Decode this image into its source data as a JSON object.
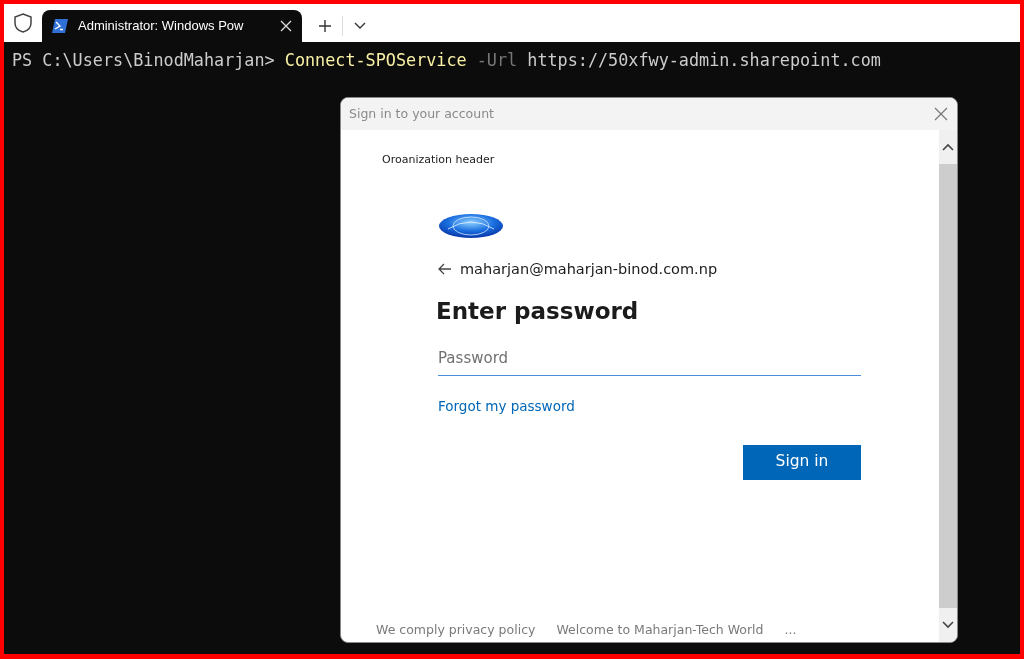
{
  "tab_bar": {
    "tabs": [
      {
        "title": "Administrator: Windows Pow",
        "selected": true
      }
    ]
  },
  "terminal": {
    "lines": [
      {
        "prompt": "PS C:\\Users\\BinodMaharjan>",
        "command": "Connect-SPOService",
        "parameter": "-Url",
        "argument": "https://50xfwy-admin.sharepoint.com"
      }
    ]
  },
  "dialog": {
    "title": "Sign in to your account",
    "organization_header": "Oroanization header",
    "account": "maharjan@maharjan-binod.com.np",
    "heading": "Enter password",
    "password_field": {
      "placeholder": "Password"
    },
    "forgot_link": "Forgot my password",
    "sign_in_button": "Sign in",
    "footer": [
      "We comply privacy policy",
      "Welcome to Maharjan-Tech World",
      "..."
    ]
  }
}
